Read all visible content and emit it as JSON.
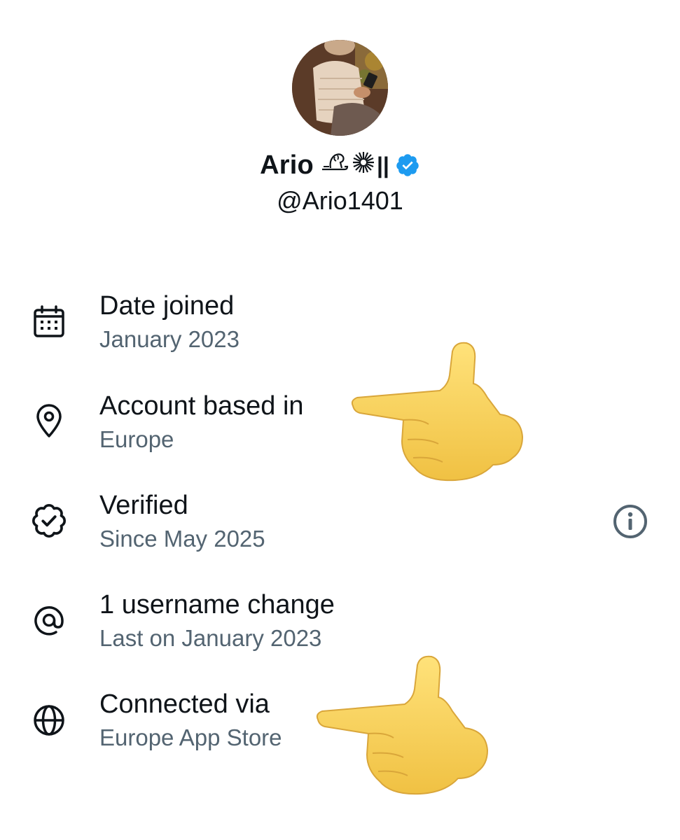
{
  "profile": {
    "display_name": "Ario",
    "name_suffix": "||",
    "handle": "@Ario1401",
    "avatar_icon": "profile-photo",
    "badge_icon": "verified-badge-icon",
    "badge_color": "#1d9bf0"
  },
  "rows": [
    {
      "icon": "calendar-icon",
      "title": "Date joined",
      "subtitle": "January 2023"
    },
    {
      "icon": "location-pin-icon",
      "title": "Account based in",
      "subtitle": "Europe"
    },
    {
      "icon": "verified-seal-icon",
      "title": "Verified",
      "subtitle": "Since May 2025"
    },
    {
      "icon": "at-sign-icon",
      "title": "1 username change",
      "subtitle": "Last on January 2023"
    },
    {
      "icon": "globe-icon",
      "title": "Connected via",
      "subtitle": "Europe App Store"
    }
  ],
  "info_button_icon": "info-icon",
  "annotations": {
    "pointer_icon": "pointing-hand-emoji",
    "pointer_color": "#f6d158"
  },
  "colors": {
    "primary_text": "#0f1419",
    "secondary_text": "#536471",
    "background": "#ffffff"
  }
}
